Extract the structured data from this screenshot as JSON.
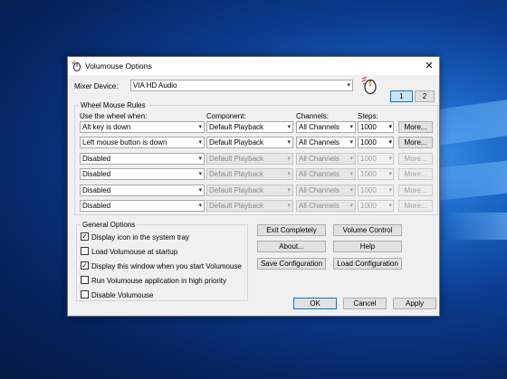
{
  "window": {
    "title": "Volumouse Options",
    "close_glyph": "✕"
  },
  "mixer": {
    "label": "Mixer Device:",
    "value": "VIA HD Audio"
  },
  "page_tabs": [
    "1",
    "2"
  ],
  "wheel_rules": {
    "title": "Wheel Mouse Rules",
    "headers": {
      "use": "Use the wheel when:",
      "component": "Component:",
      "channels": "Channels:",
      "steps": "Steps:"
    },
    "rows": [
      {
        "use": "Alt key is down",
        "component": "Default Playback",
        "channels": "All Channels",
        "steps": "1000",
        "more": "More..."
      },
      {
        "use": "Left mouse button is down",
        "component": "Default Playback",
        "channels": "All Channels",
        "steps": "1000",
        "more": "More..."
      },
      {
        "use": "Disabled",
        "component": "Default Playback",
        "channels": "All Channels",
        "steps": "1000",
        "more": "More..."
      },
      {
        "use": "Disabled",
        "component": "Default Playback",
        "channels": "All Channels",
        "steps": "1000",
        "more": "More..."
      },
      {
        "use": "Disabled",
        "component": "Default Playback",
        "channels": "All Channels",
        "steps": "1000",
        "more": "More..."
      },
      {
        "use": "Disabled",
        "component": "Default Playback",
        "channels": "All Channels",
        "steps": "1000",
        "more": "More..."
      }
    ]
  },
  "general": {
    "title": "General Options",
    "options": [
      {
        "label": "Display icon in the system tray",
        "checked": true
      },
      {
        "label": "Load Volumouse at startup",
        "checked": false
      },
      {
        "label": "Display this window when you start Volumouse",
        "checked": true
      },
      {
        "label": "Run Volumouse application in high priority",
        "checked": false
      },
      {
        "label": "Disable Volumouse",
        "checked": false
      }
    ]
  },
  "actions": {
    "exit": "Exit Completely",
    "volume_control": "Volume Control",
    "about": "About...",
    "help": "Help",
    "save_config": "Save Configuration",
    "load_config": "Load Configuration"
  },
  "footer": {
    "ok": "OK",
    "cancel": "Cancel",
    "apply": "Apply"
  },
  "icons": {
    "dropdown": "▾",
    "check": "✓"
  }
}
